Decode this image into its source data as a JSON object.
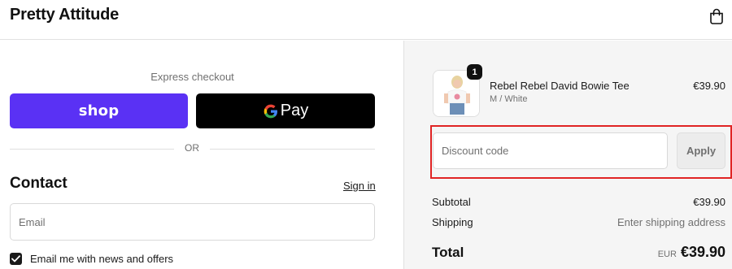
{
  "header": {
    "brand": "Pretty Attitude",
    "cart_icon": "shopping-bag-icon"
  },
  "checkout": {
    "express_label": "Express checkout",
    "shop_pay_label": "shop",
    "gpay_label": "Pay",
    "gpay_icon": "google-g-icon",
    "divider_label": "OR"
  },
  "contact": {
    "title": "Contact",
    "sign_in_label": "Sign in",
    "email_placeholder": "Email",
    "email_value": "",
    "newsletter_label": "Email me with news and offers",
    "newsletter_checked": true
  },
  "order": {
    "items": [
      {
        "name": "Rebel Rebel David Bowie Tee",
        "variant": "M / White",
        "price": "€39.90",
        "quantity": "1"
      }
    ],
    "discount_placeholder": "Discount code",
    "discount_value": "",
    "apply_label": "Apply",
    "subtotal_label": "Subtotal",
    "subtotal_value": "€39.90",
    "shipping_label": "Shipping",
    "shipping_value": "Enter shipping address",
    "total_label": "Total",
    "total_currency": "EUR",
    "total_value": "€39.90"
  },
  "colors": {
    "shop_pay": "#5a31f4",
    "gpay": "#000000",
    "highlight_box": "#e02424",
    "summary_bg": "#f5f5f5"
  }
}
